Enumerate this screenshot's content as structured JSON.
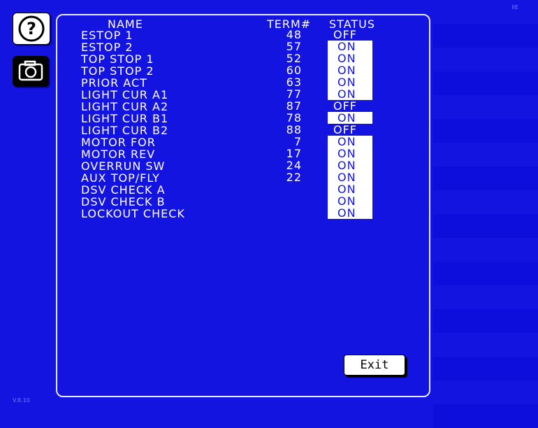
{
  "corner": {
    "top_right": "IIE",
    "bottom_left": "V.8.10"
  },
  "colors": {
    "background": "#1414e0",
    "stripe_alt": "#0e0edc",
    "highlight": "#ffffff"
  },
  "icons": {
    "help": "question-circle-icon",
    "camera": "camera-icon"
  },
  "table": {
    "headers": {
      "name": "NAME",
      "term": "TERM#",
      "status": "STATUS"
    },
    "rows": [
      {
        "name": "ESTOP 1",
        "term": "48",
        "status": "OFF"
      },
      {
        "name": "ESTOP 2",
        "term": "57",
        "status": "ON"
      },
      {
        "name": "TOP STOP 1",
        "term": "52",
        "status": "ON"
      },
      {
        "name": "TOP STOP 2",
        "term": "60",
        "status": "ON"
      },
      {
        "name": "PRIOR ACT",
        "term": "63",
        "status": "ON"
      },
      {
        "name": "LIGHT CUR A1",
        "term": "77",
        "status": "ON"
      },
      {
        "name": "LIGHT CUR A2",
        "term": "87",
        "status": "OFF"
      },
      {
        "name": "LIGHT CUR B1",
        "term": "78",
        "status": "ON"
      },
      {
        "name": "LIGHT CUR B2",
        "term": "88",
        "status": "OFF"
      },
      {
        "name": "MOTOR FOR",
        "term": "7",
        "status": "ON"
      },
      {
        "name": "MOTOR REV",
        "term": "17",
        "status": "ON"
      },
      {
        "name": "OVERRUN SW",
        "term": "24",
        "status": "ON"
      },
      {
        "name": "AUX TOP/FLY",
        "term": "22",
        "status": "ON"
      },
      {
        "name": "DSV CHECK A",
        "term": "",
        "status": "ON"
      },
      {
        "name": "DSV CHECK B",
        "term": "",
        "status": "ON"
      },
      {
        "name": "LOCKOUT CHECK",
        "term": "",
        "status": "ON"
      }
    ]
  },
  "exit_label": "Exit"
}
